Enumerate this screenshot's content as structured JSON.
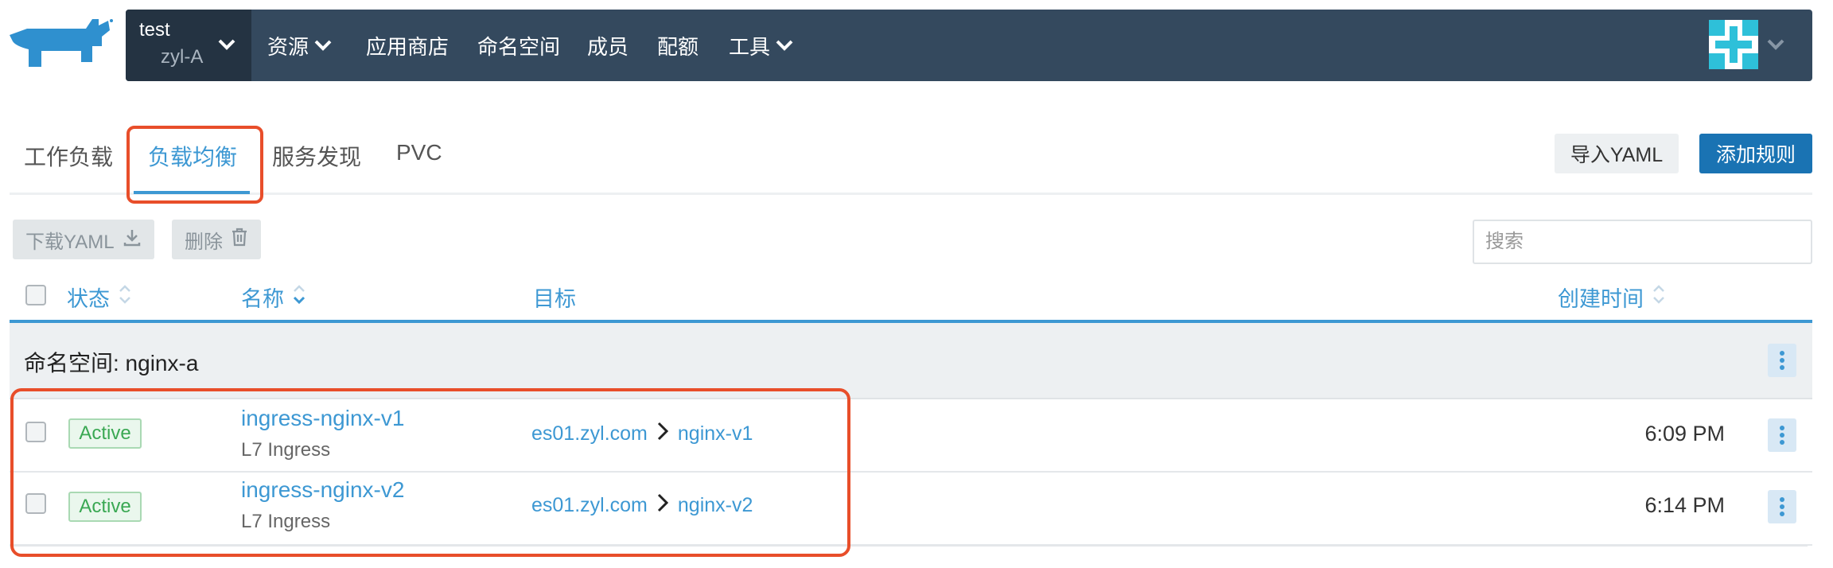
{
  "header": {
    "cluster_name": "test",
    "project_name": "zyl-A",
    "nav": [
      {
        "label": "资源",
        "has_dropdown": true
      },
      {
        "label": "应用商店",
        "has_dropdown": false
      },
      {
        "label": "命名空间",
        "has_dropdown": false
      },
      {
        "label": "成员",
        "has_dropdown": false
      },
      {
        "label": "配额",
        "has_dropdown": false
      },
      {
        "label": "工具",
        "has_dropdown": true
      }
    ]
  },
  "tabs": [
    {
      "label": "工作负载",
      "active": false
    },
    {
      "label": "负载均衡",
      "active": true
    },
    {
      "label": "服务发现",
      "active": false
    },
    {
      "label": "PVC",
      "active": false
    }
  ],
  "actions": {
    "import_yaml": "导入YAML",
    "add_rule": "添加规则"
  },
  "bulk": {
    "download_yaml": "下载YAML",
    "delete": "删除"
  },
  "search": {
    "placeholder": "搜索",
    "value": ""
  },
  "table": {
    "columns": {
      "state": "状态",
      "name": "名称",
      "target": "目标",
      "created": "创建时间"
    },
    "group_label": "命名空间: nginx-a",
    "rows": [
      {
        "state": "Active",
        "name": "ingress-nginx-v1",
        "type": "L7 Ingress",
        "host": "es01.zyl.com",
        "service": "nginx-v1",
        "created": "6:09 PM"
      },
      {
        "state": "Active",
        "name": "ingress-nginx-v2",
        "type": "L7 Ingress",
        "host": "es01.zyl.com",
        "service": "nginx-v2",
        "created": "6:14 PM"
      }
    ]
  },
  "colors": {
    "topbar": "#34495e",
    "accent": "#3d98d3",
    "primary_button": "#1a73b3",
    "active_badge": "#3aa853",
    "highlight": "#e84e2a"
  }
}
